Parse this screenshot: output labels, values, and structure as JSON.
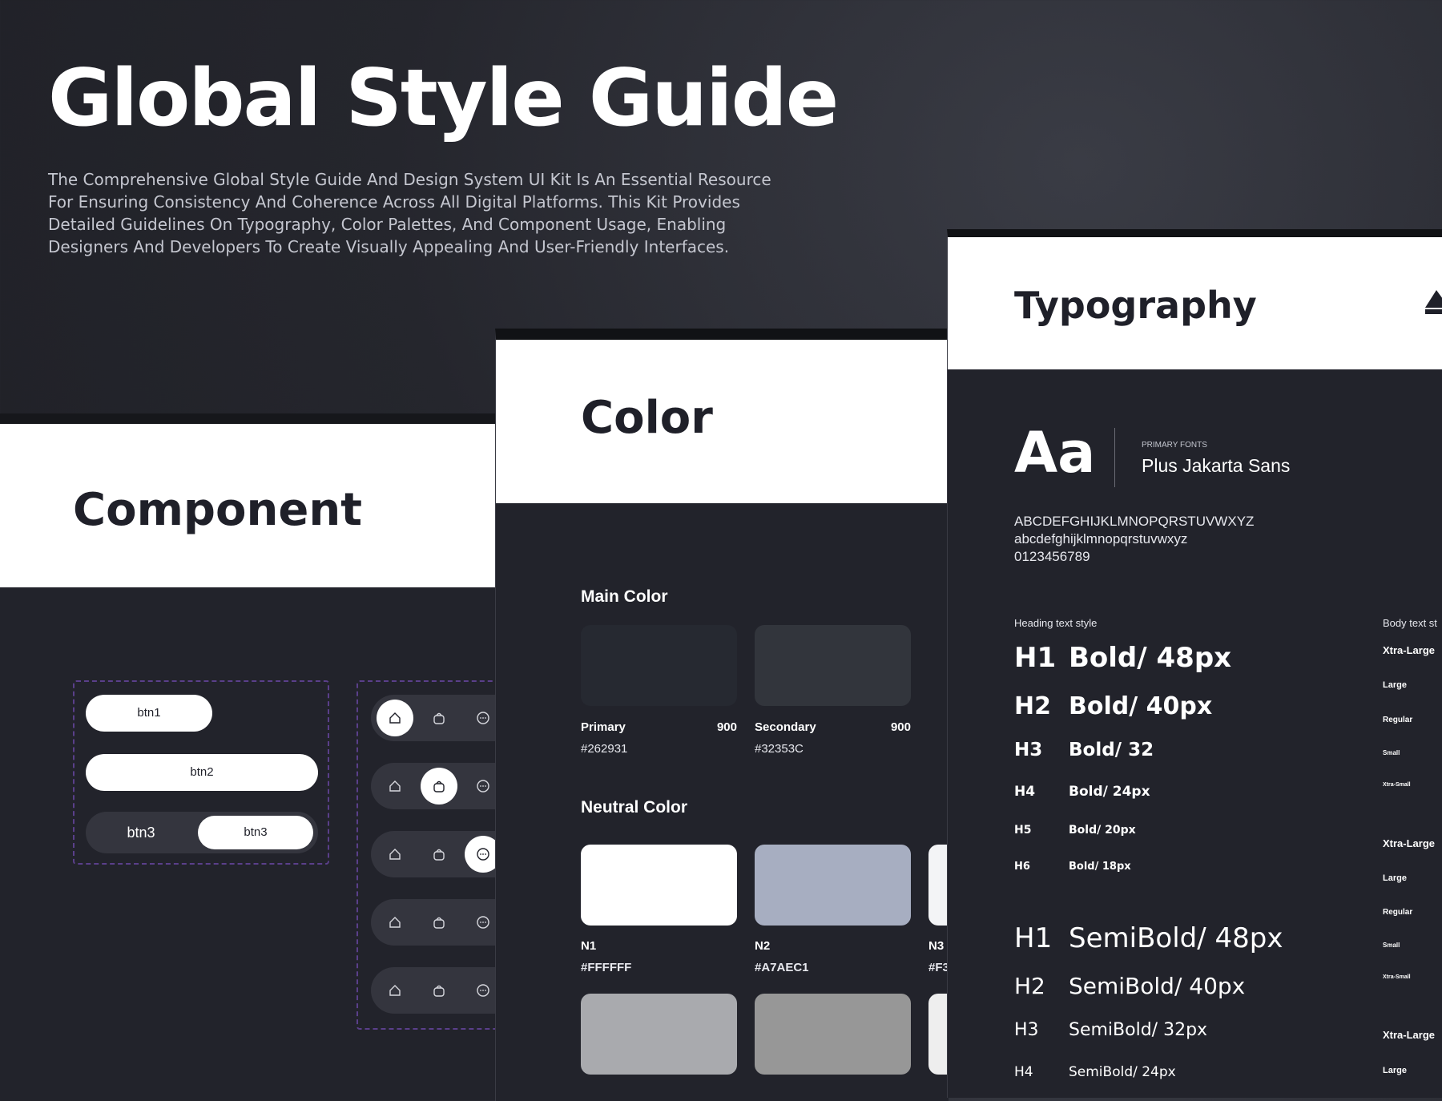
{
  "hero": {
    "title": "Global Style Guide",
    "description": "The Comprehensive Global Style Guide And Design System UI Kit Is An Essential Resource For Ensuring Consistency And Coherence Across All Digital Platforms. This Kit Provides Detailed Guidelines On Typography, Color Palettes, And Component Usage, Enabling Designers And Developers To Create Visually Appealing And User-Friendly Interfaces."
  },
  "component": {
    "title": "Component",
    "btn1": "btn1",
    "btn2": "btn2",
    "btn3_left": "btn3",
    "btn3_right": "btn3"
  },
  "color": {
    "title": "Color",
    "main_label": "Main Color",
    "main": [
      {
        "name": "Primary",
        "weight": "900",
        "hex": "#262931",
        "swatch": "#262931"
      },
      {
        "name": "Secondary",
        "weight": "900",
        "hex": "#32353C",
        "swatch": "#32353C"
      }
    ],
    "neutral_label": "Neutral Color",
    "neutral": [
      {
        "name": "N1",
        "hex": "#FFFFFF",
        "swatch": "#FFFFFF"
      },
      {
        "name": "N2",
        "hex": "#A7AEC1",
        "swatch": "#A7AEC1"
      },
      {
        "name": "N3",
        "hex": "#F3",
        "swatch": "#F3F4F6"
      }
    ],
    "neutral_row2": [
      "#A9AAAE",
      "#979797",
      "#EEEEEE"
    ]
  },
  "typography": {
    "title": "Typography",
    "aa": "Aa",
    "font_label": "PRIMARY FONTS",
    "font_name": "Plus Jakarta Sans",
    "upper": "ABCDEFGHIJKLMNOPQRSTUVWXYZ",
    "lower": "abcdefghijklmnopqrstuvwxyz",
    "digits": "0123456789",
    "heading_label": "Heading text style",
    "body_label": "Body text st",
    "bold": [
      {
        "tag": "H1",
        "spec": "Bold/ 48px"
      },
      {
        "tag": "H2",
        "spec": "Bold/ 40px"
      },
      {
        "tag": "H3",
        "spec": "Bold/ 32"
      },
      {
        "tag": "H4",
        "spec": "Bold/ 24px"
      },
      {
        "tag": "H5",
        "spec": "Bold/ 20px"
      },
      {
        "tag": "H6",
        "spec": "Bold/ 18px"
      }
    ],
    "semibold": [
      {
        "tag": "H1",
        "spec": "SemiBold/ 48px"
      },
      {
        "tag": "H2",
        "spec": "SemiBold/ 40px"
      },
      {
        "tag": "H3",
        "spec": "SemiBold/ 32px"
      },
      {
        "tag": "H4",
        "spec": "SemiBold/ 24px"
      }
    ],
    "body_sizes": [
      "Xtra-Large",
      "Large",
      "Regular",
      "Small",
      "Xtra-Small",
      "Xtra-Large",
      "Large",
      "Regular",
      "Small",
      "Xtra-Small",
      "Xtra-Large",
      "Large"
    ]
  }
}
